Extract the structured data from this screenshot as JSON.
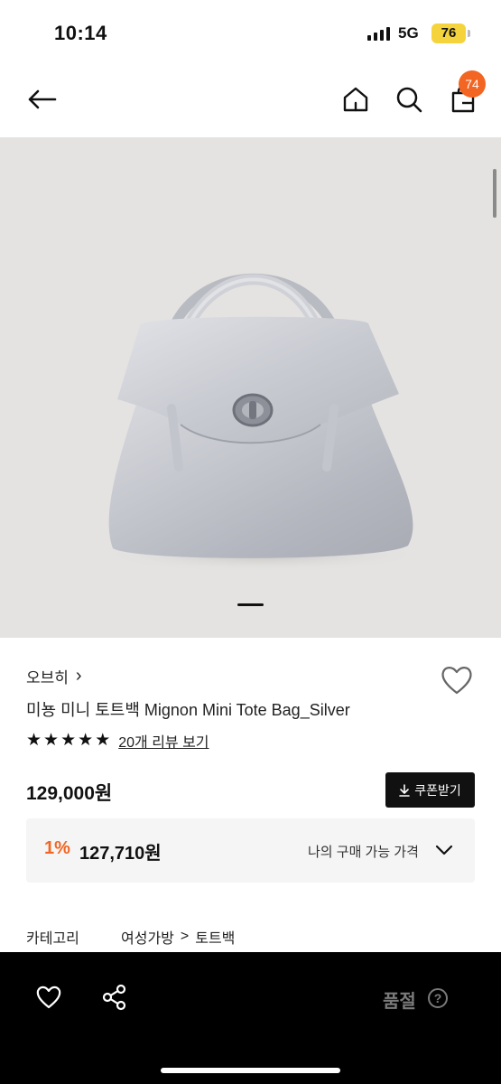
{
  "status_bar": {
    "time": "10:14",
    "network": "5G",
    "battery": "76"
  },
  "header": {
    "back_icon": "arrow-left-icon",
    "home_icon": "home-icon",
    "search_icon": "search-icon",
    "cart_icon": "shopping-bag-icon",
    "cart_count": "74"
  },
  "product": {
    "brand": "오브히",
    "brand_chevron": "›",
    "name": "미뇽 미니 토트백 Mignon Mini Tote Bag_Silver",
    "rating_stars": 5,
    "review_link": "20개 리뷰 보기",
    "price": "129,000원",
    "coupon_label": "쿠폰받기",
    "discount_rate": "1%",
    "my_price": "127,710원",
    "my_price_label": "나의 구매 가능 가격",
    "image_page": 1
  },
  "category": {
    "label": "카테고리",
    "path": [
      "여성가방",
      "토트백"
    ],
    "separator": ">"
  },
  "bottom_bar": {
    "soldout_label": "품절",
    "help_label": "?"
  },
  "colors": {
    "accent": "#f26522",
    "image_bg": "#e4e3e1",
    "box_bg": "#f5f5f5",
    "bottom_bar": "#000000",
    "battery": "#f5d33c"
  }
}
